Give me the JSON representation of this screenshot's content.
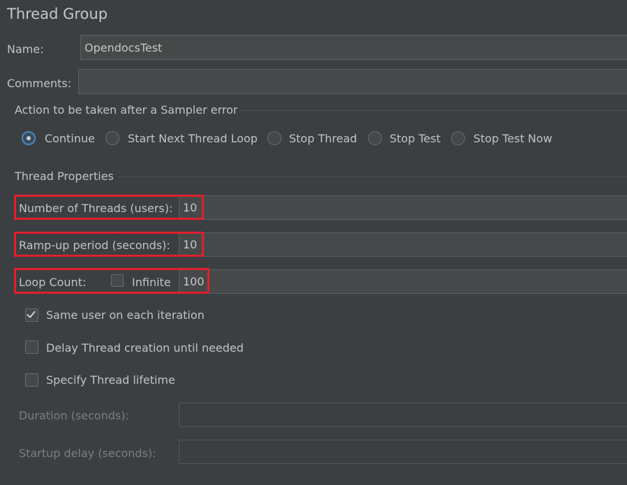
{
  "header": {
    "title": "Thread Group"
  },
  "name": {
    "label": "Name:",
    "value": "OpendocsTest"
  },
  "comments": {
    "label": "Comments:",
    "value": ""
  },
  "sampler_error": {
    "label": "Action to be taken after a Sampler error",
    "options": [
      "Continue",
      "Start Next Thread Loop",
      "Stop Thread",
      "Stop Test",
      "Stop Test Now"
    ],
    "selected": "Continue"
  },
  "thread_props": {
    "label": "Thread Properties",
    "num_threads": {
      "label": "Number of Threads (users):",
      "value": "10"
    },
    "ramp_up": {
      "label": "Ramp-up period (seconds):",
      "value": "10"
    },
    "loop_count": {
      "label": "Loop Count:",
      "infinite_label": "Infinite",
      "infinite_checked": false,
      "value": "100"
    },
    "same_user": {
      "label": "Same user on each iteration",
      "checked": true
    },
    "delay_thread": {
      "label": "Delay Thread creation until needed",
      "checked": false
    },
    "specify_lifetime": {
      "label": "Specify Thread lifetime",
      "checked": false
    },
    "duration": {
      "label": "Duration (seconds):",
      "value": ""
    },
    "startup_delay": {
      "label": "Startup delay (seconds):",
      "value": ""
    }
  },
  "colors": {
    "background": "#3c3f41",
    "field": "#45494a",
    "highlight": "#e0202a",
    "radio_accent": "#4a88c7"
  }
}
